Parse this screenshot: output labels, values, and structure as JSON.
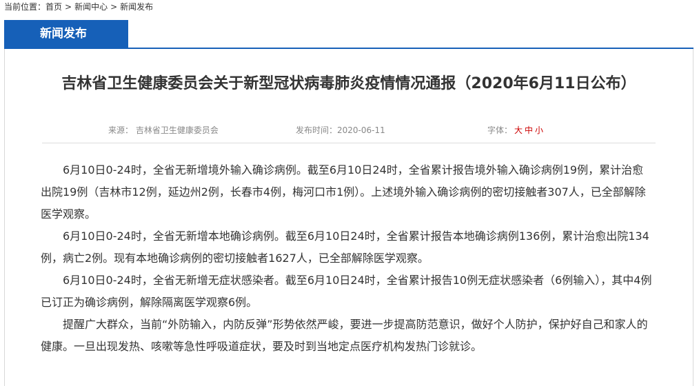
{
  "breadcrumb": {
    "prefix": "当前位置：",
    "items": [
      "首页",
      "新闻中心",
      "新闻发布"
    ],
    "separator": ">"
  },
  "tab": {
    "active_label": "新闻发布"
  },
  "article": {
    "title": "吉林省卫生健康委员会关于新型冠状病毒肺炎疫情情况通报（2020年6月11日公布）",
    "meta": {
      "source_label": "来源：",
      "source_value": "吉林省卫生健康委员会",
      "date_label": "发布时间：",
      "date_value": "2020-06-11",
      "font_label": "字体：",
      "font_large": "大",
      "font_medium": "中",
      "font_small": "小"
    },
    "paragraphs": [
      "6月10日0-24时，全省无新增境外输入确诊病例。截至6月10日24时，全省累计报告境外输入确诊病例19例，累计治愈出院19例（吉林市12例，延边州2例，长春市4例，梅河口市1例）。上述境外输入确诊病例的密切接触者307人，已全部解除医学观察。",
      "6月10日0-24时，全省无新增本地确诊病例。截至6月10日24时，全省累计报告本地确诊病例136例，累计治愈出院134例，病亡2例。现有本地确诊病例的密切接触者1627人，已全部解除医学观察。",
      "6月10日0-24时，全省无新增无症状感染者。截至6月10日24时，全省累计报告10例无症状感染者（6例输入），其中4例已订正为确诊病例，解除隔离医学观察6例。",
      "提醒广大群众，当前“外防输入，内防反弹”形势依然严峻，要进一步提高防范意识，做好个人防护，保护好自己和家人的健康。一旦出现发热、咳嗽等急性呼吸道症状，要及时到当地定点医疗机构发热门诊就诊。"
    ]
  },
  "colors": {
    "accent": "#1660b8",
    "font_option": "#cc0000"
  }
}
